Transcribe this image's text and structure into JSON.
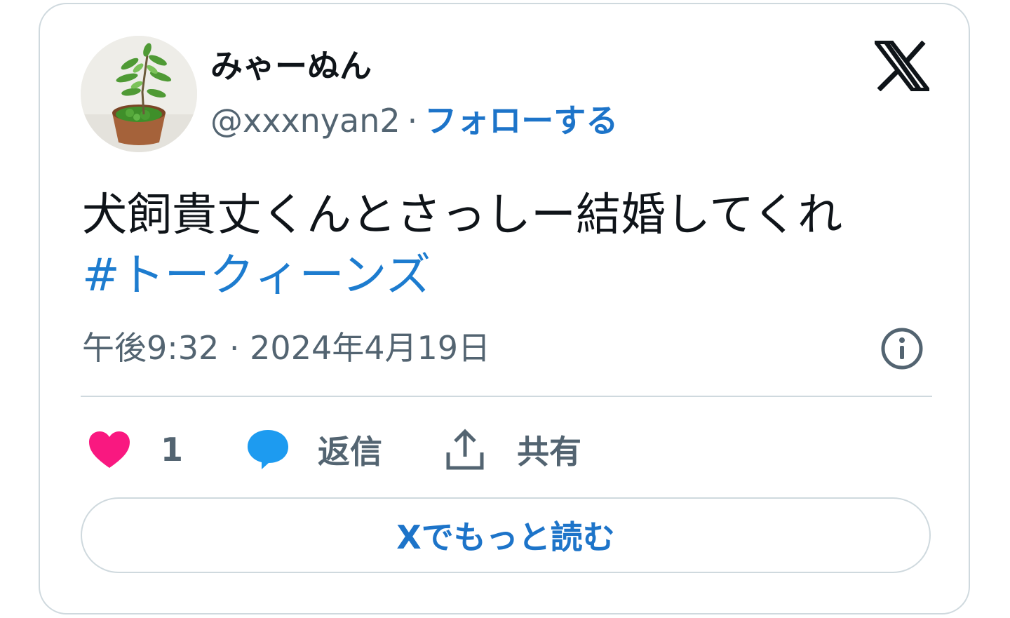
{
  "author": {
    "display_name": "みゃーぬん",
    "handle": "@xxxnyan2",
    "separator": "·",
    "follow_label": "フォローする"
  },
  "tweet": {
    "text": "犬飼貴丈くんとさっしー結婚してくれ",
    "hashtag": "#トークィーンズ",
    "timestamp": "午後9:32 · 2024年4月19日"
  },
  "actions": {
    "like_count": "1",
    "reply_label": "返信",
    "share_label": "共有"
  },
  "read_more_label": "Xでもっと読む",
  "icons": {
    "brand": "x-logo-icon",
    "info": "info-icon",
    "like": "heart-icon",
    "reply": "speech-bubble-icon",
    "share": "upload-icon"
  },
  "colors": {
    "text": "#0f1419",
    "secondary": "#536471",
    "link": "#1d74c9",
    "heart": "#f91880",
    "reply": "#1d9bf0",
    "border": "#cfd9de"
  }
}
